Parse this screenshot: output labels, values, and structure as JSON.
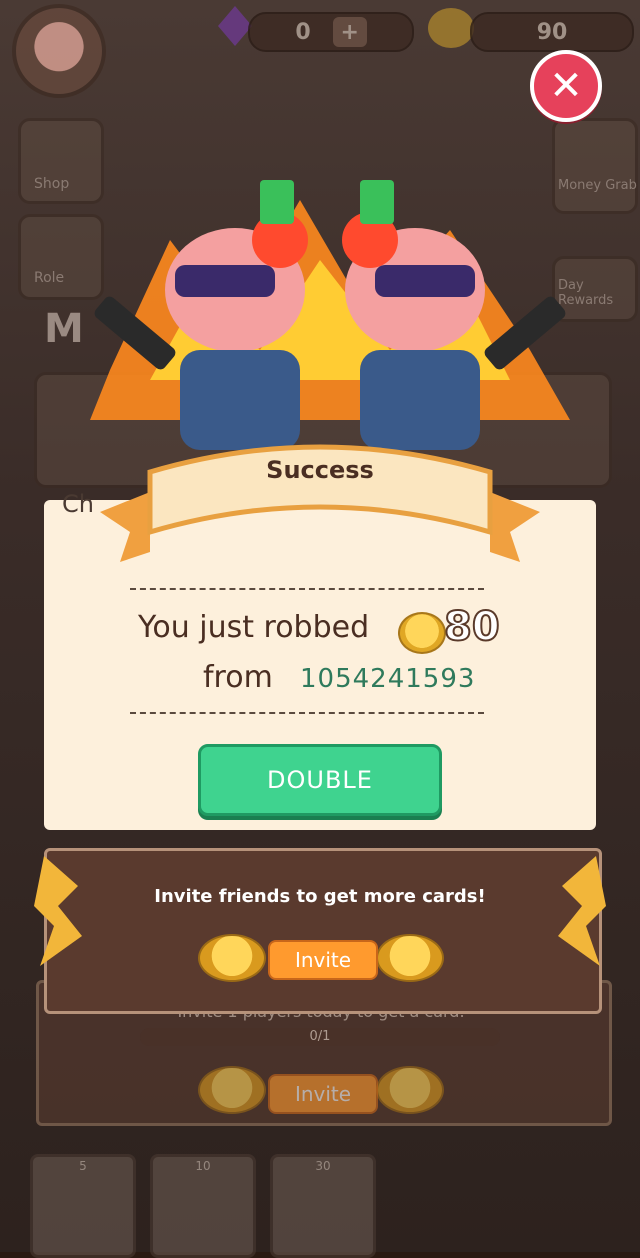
{
  "top_bar": {
    "gems_value": "0",
    "coins_value": "90",
    "plus_label": "+"
  },
  "close": {
    "label": "✕"
  },
  "popup": {
    "title": "Success",
    "robbed_text": "You just robbed",
    "robbed_amount": "80",
    "from_text": "from",
    "victim_id": "1054241593",
    "double_label": "DOUBLE"
  },
  "invite": {
    "title": "Invite friends to get more cards!",
    "button_label": "Invite",
    "task_text": "Invite 1 players today to get a card.",
    "progress_text": "0/1",
    "progress_fraction": 0,
    "button_label_2": "Invite"
  },
  "background": {
    "side_labels": [
      "Shop",
      "Role",
      "Money Grab",
      "Day Rewards"
    ],
    "partial_label": "Ch",
    "big_letter": "M"
  },
  "cards": [
    {
      "cost": "5"
    },
    {
      "cost": "10"
    },
    {
      "cost": "30"
    }
  ],
  "colors": {
    "double_button": "#3fd38f",
    "close_button": "#e6415b",
    "invite_button": "#ff9a2e",
    "victim_id": "#2f7a5c"
  }
}
